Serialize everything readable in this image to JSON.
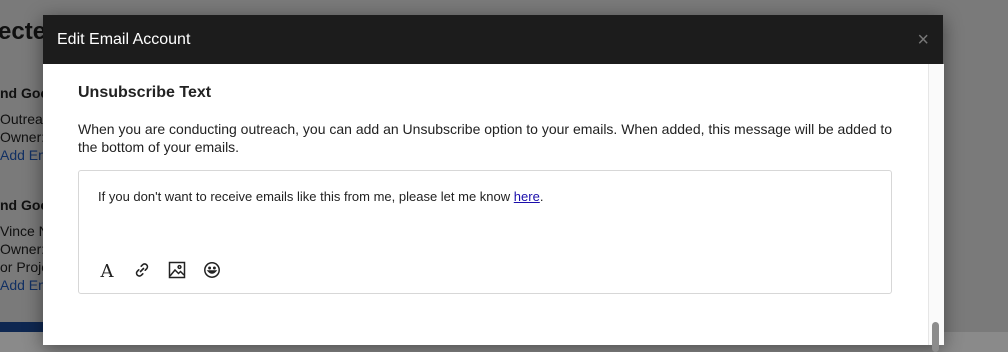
{
  "background": {
    "heading": "ectec",
    "cards": [
      {
        "name": "nd Goo",
        "line1": "Outreac",
        "line2": "Owner:",
        "link": "Add Em"
      },
      {
        "name": "nd Goo",
        "line1": "Vince N",
        "line2": "Owner:",
        "line3": "or Proje",
        "link": "Add Em"
      }
    ]
  },
  "modal": {
    "title": "Edit Email Account",
    "close_symbol": "×",
    "section": {
      "title": "Unsubscribe Text",
      "description": "When you are conducting outreach, you can add an Unsubscribe option to your emails. When added, this message will be added to the bottom of your emails."
    },
    "editor": {
      "text_before": "If you don't want to receive emails like this from me, please let me know ",
      "link_text": "here",
      "text_after": ".",
      "toolbar": [
        "text-format-icon",
        "link-icon",
        "image-icon",
        "emoji-icon"
      ]
    }
  },
  "colors": {
    "header_bg": "#1c1c1c",
    "link": "#1a0dab"
  }
}
